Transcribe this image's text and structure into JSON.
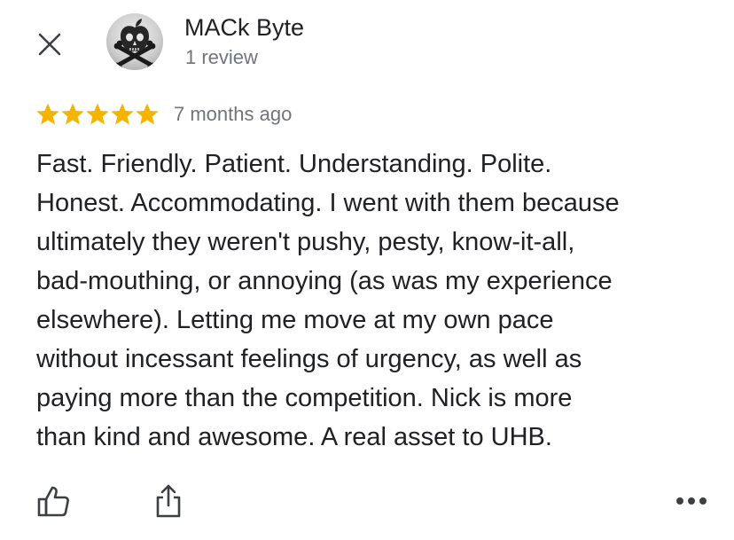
{
  "header": {
    "close_icon": "close-icon",
    "author_name": "MACk Byte",
    "review_count": "1 review",
    "avatar_icon": "skull-crossbones-apple-avatar"
  },
  "rating": {
    "stars": 5,
    "max_stars": 5,
    "star_color": "#f4b400",
    "time": "7 months ago"
  },
  "review": {
    "lines": [
      "Fast. Friendly. Patient. Understanding. Polite.",
      "Honest. Accommodating. I went with them because",
      "ultimately they weren't pushy, pesty, know-it-all,",
      "bad-mouthing, or annoying (as was my experience",
      "elsewhere). Letting me move at my own pace",
      "without incessant feelings of urgency, as well as",
      "paying more than the competition. Nick is more",
      "than kind and awesome. A real asset to UHB."
    ]
  },
  "actions": {
    "like_icon": "thumbs-up-icon",
    "share_icon": "share-icon",
    "more_icon": "more-horizontal-icon"
  },
  "colors": {
    "text_primary": "#202124",
    "text_secondary": "#70757a",
    "icon": "#3c4043"
  }
}
